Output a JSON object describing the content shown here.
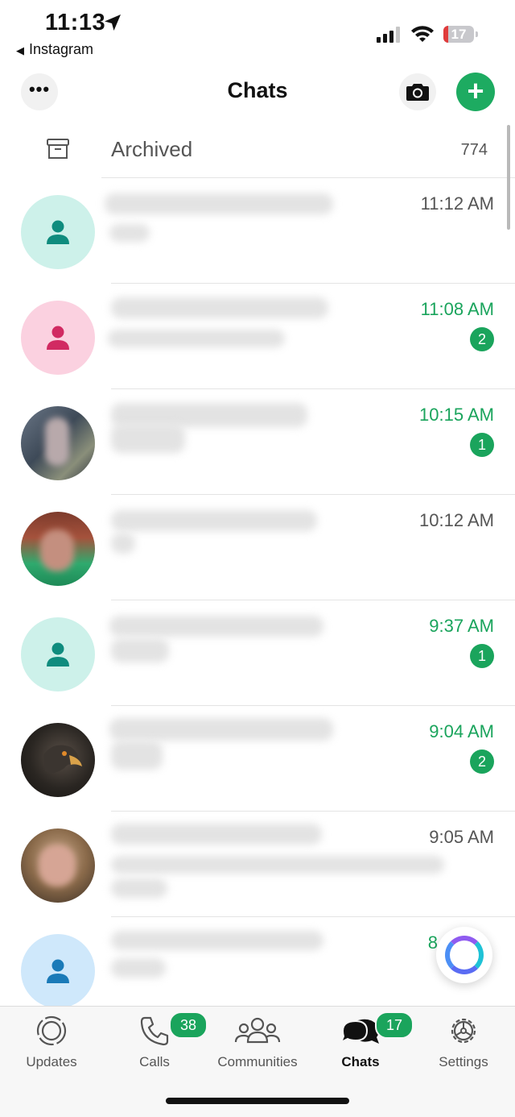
{
  "status_bar": {
    "time": "11:13",
    "back_app": "Instagram",
    "battery": "17",
    "battery_level": 0.17
  },
  "header": {
    "title": "Chats",
    "more_label": "•••"
  },
  "archived": {
    "label": "Archived",
    "count": "774"
  },
  "chats": [
    {
      "time": "11:12 AM",
      "unread": false,
      "badge": ""
    },
    {
      "time": "11:08 AM",
      "unread": true,
      "badge": "2"
    },
    {
      "time": "10:15 AM",
      "unread": true,
      "badge": "1"
    },
    {
      "time": "10:12 AM",
      "unread": false,
      "badge": ""
    },
    {
      "time": "9:37 AM",
      "unread": true,
      "badge": "1"
    },
    {
      "time": "9:04 AM",
      "unread": true,
      "badge": "2"
    },
    {
      "time": "9:05 AM",
      "unread": false,
      "badge": ""
    },
    {
      "time": "8",
      "unread": true,
      "badge": ""
    }
  ],
  "tabs": [
    {
      "label": "Updates",
      "icon": "updates-icon",
      "badge": ""
    },
    {
      "label": "Calls",
      "icon": "phone-icon",
      "badge": "38"
    },
    {
      "label": "Communities",
      "icon": "communities-icon",
      "badge": ""
    },
    {
      "label": "Chats",
      "icon": "chats-icon",
      "badge": "17"
    },
    {
      "label": "Settings",
      "icon": "gear-icon",
      "badge": ""
    }
  ],
  "colors": {
    "accent": "#1aa45c",
    "unread_time": "#1aa45c",
    "battery_low": "#e03b3b"
  }
}
